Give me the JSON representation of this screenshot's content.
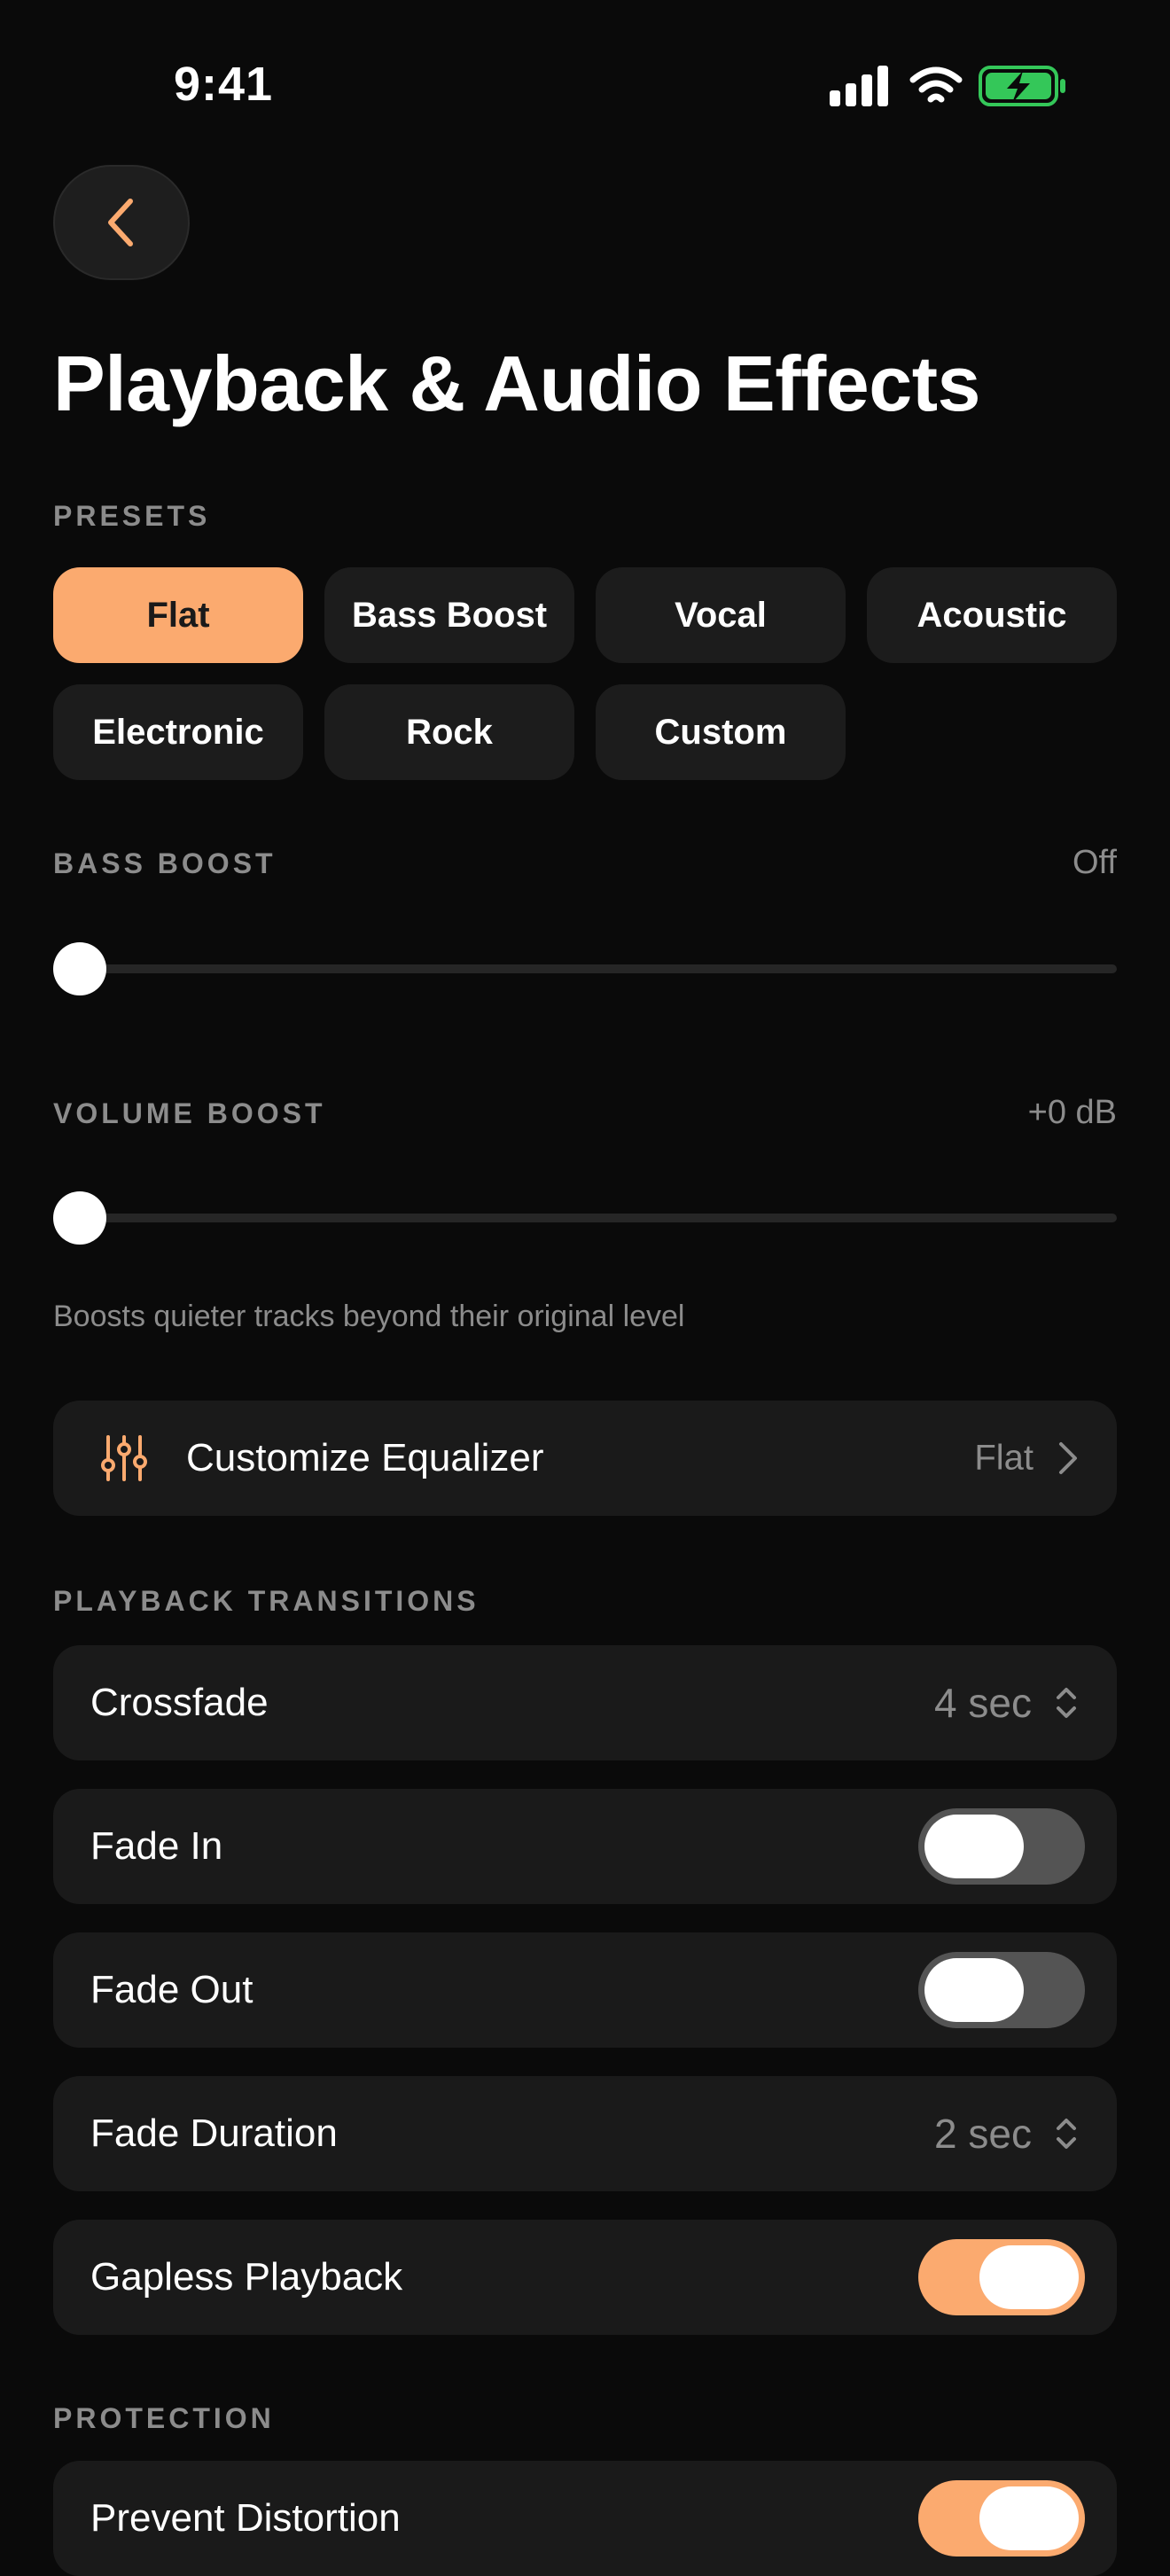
{
  "status_bar": {
    "time": "9:41",
    "icons": [
      "cellular-signal-icon",
      "wifi-icon",
      "battery-charging-icon"
    ]
  },
  "header": {
    "back_icon": "chevron-left-icon",
    "title": "Playback & Audio Effects"
  },
  "presets": {
    "label": "PRESETS",
    "items": [
      "Flat",
      "Bass Boost",
      "Vocal",
      "Acoustic",
      "Electronic",
      "Rock",
      "Custom"
    ],
    "selected": "Flat"
  },
  "bass_boost": {
    "label": "BASS BOOST",
    "value": "Off",
    "level": 0
  },
  "volume_boost": {
    "label": "VOLUME BOOST",
    "value": "+0 dB",
    "level": 0,
    "helper": "Boosts quieter tracks beyond their original level"
  },
  "equalizer": {
    "icon": "sliders-icon",
    "label": "Customize Equalizer",
    "value": "Flat"
  },
  "transitions": {
    "label": "PLAYBACK TRANSITIONS",
    "crossfade": {
      "label": "Crossfade",
      "value": "4 sec"
    },
    "fade_in": {
      "label": "Fade In",
      "on": false
    },
    "fade_out": {
      "label": "Fade Out",
      "on": false
    },
    "fade_duration": {
      "label": "Fade Duration",
      "value": "2 sec"
    },
    "gapless": {
      "label": "Gapless Playback",
      "on": true
    }
  },
  "protection": {
    "label": "PROTECTION",
    "prevent_distortion": {
      "label": "Prevent Distortion",
      "on": true
    }
  },
  "colors": {
    "accent": "#fbaa6f",
    "background": "#0a0a0a",
    "surface": "#1a1a1a",
    "secondary_text": "#8c8c8c",
    "battery": "#34c759"
  }
}
